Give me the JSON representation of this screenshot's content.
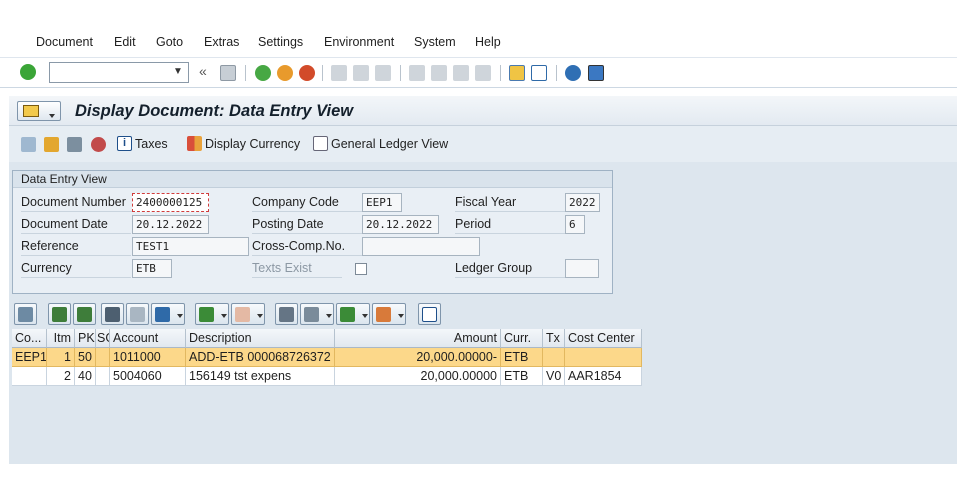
{
  "menu": {
    "items": [
      "Document",
      "Edit",
      "Goto",
      "Extras",
      "Settings",
      "Environment",
      "System",
      "Help"
    ]
  },
  "toolbar": {
    "command_value": "",
    "icons": [
      "enter-icon",
      "back-icon",
      "save-icon",
      "back-nav-icon",
      "exit-icon",
      "cancel-icon",
      "print-icon",
      "find-icon",
      "find-next-icon",
      "first-page-icon",
      "prev-page-icon",
      "next-page-icon",
      "last-page-icon",
      "new-session-icon",
      "shortcut-icon",
      "help-icon",
      "customize-icon"
    ]
  },
  "title": "Display Document: Data Entry View",
  "appbar": {
    "taxes_label": "Taxes",
    "display_currency_label": "Display Currency",
    "gl_view_label": "General Ledger View"
  },
  "header": {
    "group_title": "Data Entry View",
    "document_number_label": "Document Number",
    "document_number": "2400000125",
    "company_code_label": "Company Code",
    "company_code": "EEP1",
    "fiscal_year_label": "Fiscal Year",
    "fiscal_year": "2022",
    "document_date_label": "Document Date",
    "document_date": "20.12.2022",
    "posting_date_label": "Posting Date",
    "posting_date": "20.12.2022",
    "period_label": "Period",
    "period": "6",
    "reference_label": "Reference",
    "reference": "TEST1",
    "cross_comp_label": "Cross-Comp.No.",
    "cross_comp": "",
    "currency_label": "Currency",
    "currency": "ETB",
    "texts_exist_label": "Texts Exist",
    "ledger_group_label": "Ledger Group",
    "ledger_group": ""
  },
  "grid": {
    "columns": [
      "Co...",
      "Itm",
      "PK",
      "SG",
      "Account",
      "Description",
      "Amount",
      "Curr.",
      "Tx",
      "Cost Center"
    ],
    "rows": [
      {
        "co": "EEP1",
        "itm": "1",
        "pk": "50",
        "sg": "",
        "account": "1011000",
        "description": "ADD-ETB 000068726372",
        "amount": "20,000.00000-",
        "curr": "ETB",
        "tx": "",
        "cost_center": ""
      },
      {
        "co": "",
        "itm": "2",
        "pk": "40",
        "sg": "",
        "account": "5004060",
        "description": "156149 tst expens",
        "amount": "20,000.00000",
        "curr": "ETB",
        "tx": "V0",
        "cost_center": "AAR1854"
      }
    ]
  },
  "colors": {
    "selected_row": "#fcd88a",
    "background": "#dde6ee",
    "title_bar": "#e3eaf1"
  }
}
